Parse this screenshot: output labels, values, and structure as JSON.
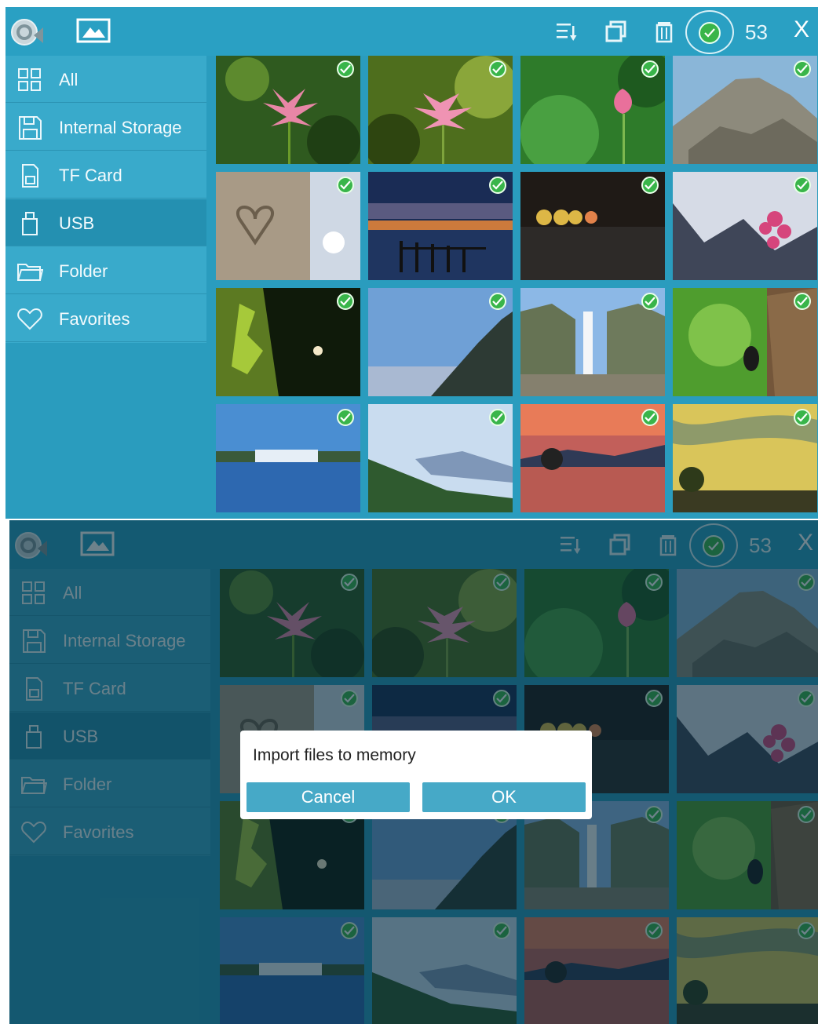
{
  "toolbar": {
    "count": "53",
    "close_label": "X"
  },
  "sidebar": {
    "items": [
      {
        "label": "All",
        "icon": "grid-icon"
      },
      {
        "label": "Internal Storage",
        "icon": "floppy-icon"
      },
      {
        "label": "TF Card",
        "icon": "sd-card-icon"
      },
      {
        "label": "USB",
        "icon": "usb-icon"
      },
      {
        "label": "Folder",
        "icon": "folder-icon"
      },
      {
        "label": "Favorites",
        "icon": "heart-icon"
      }
    ],
    "active_index": 3
  },
  "photos": [
    {
      "subject": "pink lotus flower"
    },
    {
      "subject": "pink lotus flower among leaves"
    },
    {
      "subject": "lotus bud over green leaves"
    },
    {
      "subject": "rocky mountain peak"
    },
    {
      "subject": "heart drawn in sand with sun"
    },
    {
      "subject": "pier at dusk"
    },
    {
      "subject": "blurred city lights at night"
    },
    {
      "subject": "pink blossom tree by mountains"
    },
    {
      "subject": "mossy tree and flowers"
    },
    {
      "subject": "cliff with blue sky"
    },
    {
      "subject": "waterfall in canyon"
    },
    {
      "subject": "beetle on tree bark"
    },
    {
      "subject": "lakeside building"
    },
    {
      "subject": "misty blue mountains"
    },
    {
      "subject": "sunset over lake"
    },
    {
      "subject": "golden sky with tree"
    }
  ],
  "dialog": {
    "message": "Import files to memory",
    "cancel_label": "Cancel",
    "ok_label": "OK"
  },
  "colors": {
    "accent": "#2a9cbe",
    "check": "#39b54a",
    "dialog_button": "#46a9c7"
  }
}
